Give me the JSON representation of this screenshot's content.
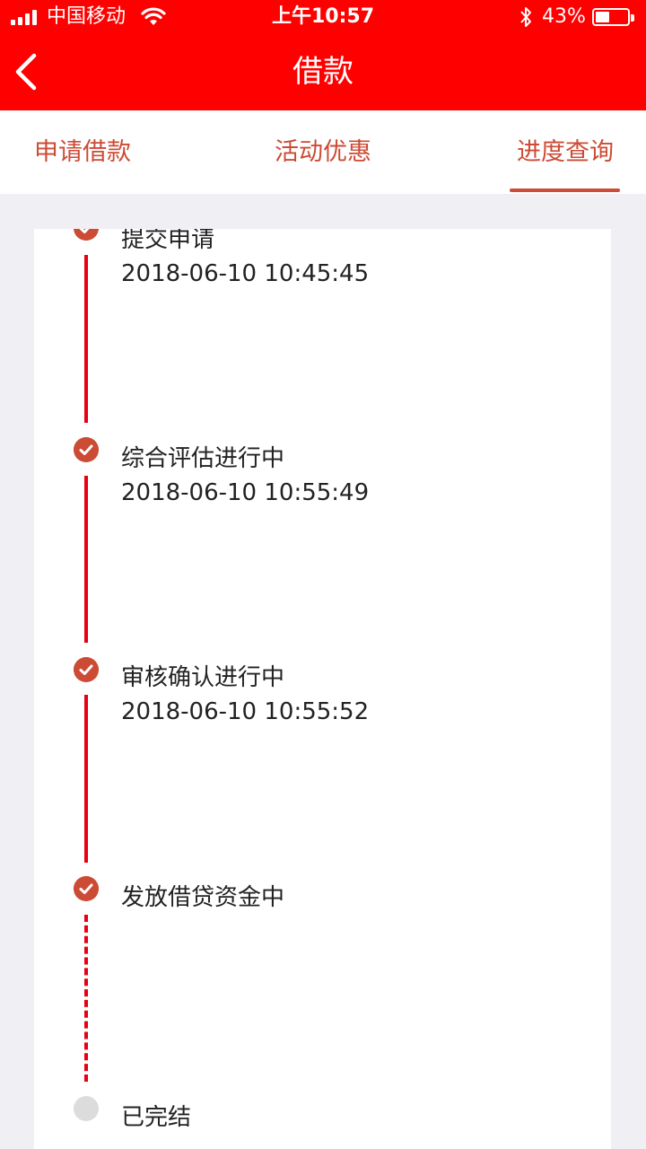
{
  "status_bar": {
    "carrier": "中国移动",
    "time": "上午10:57",
    "battery_percent": "43%",
    "battery_level": 0.43
  },
  "nav": {
    "title": "借款"
  },
  "tabs": [
    {
      "label": "申请借款",
      "active": false
    },
    {
      "label": "活动优惠",
      "active": false
    },
    {
      "label": "进度查询",
      "active": true
    }
  ],
  "timeline": [
    {
      "title": "提交申请",
      "time": "2018-06-10 10:45:45",
      "done": true
    },
    {
      "title": "综合评估进行中",
      "time": "2018-06-10 10:55:49",
      "done": true
    },
    {
      "title": "审核确认进行中",
      "time": "2018-06-10 10:55:52",
      "done": true
    },
    {
      "title": "发放借贷资金中",
      "time": "",
      "done": true
    },
    {
      "title": "已完结",
      "time": "",
      "done": false
    }
  ],
  "colors": {
    "header_red": "#ff0000",
    "accent": "#cc4b35",
    "line_red": "#e60012",
    "pending_gray": "#dcdcdc"
  }
}
